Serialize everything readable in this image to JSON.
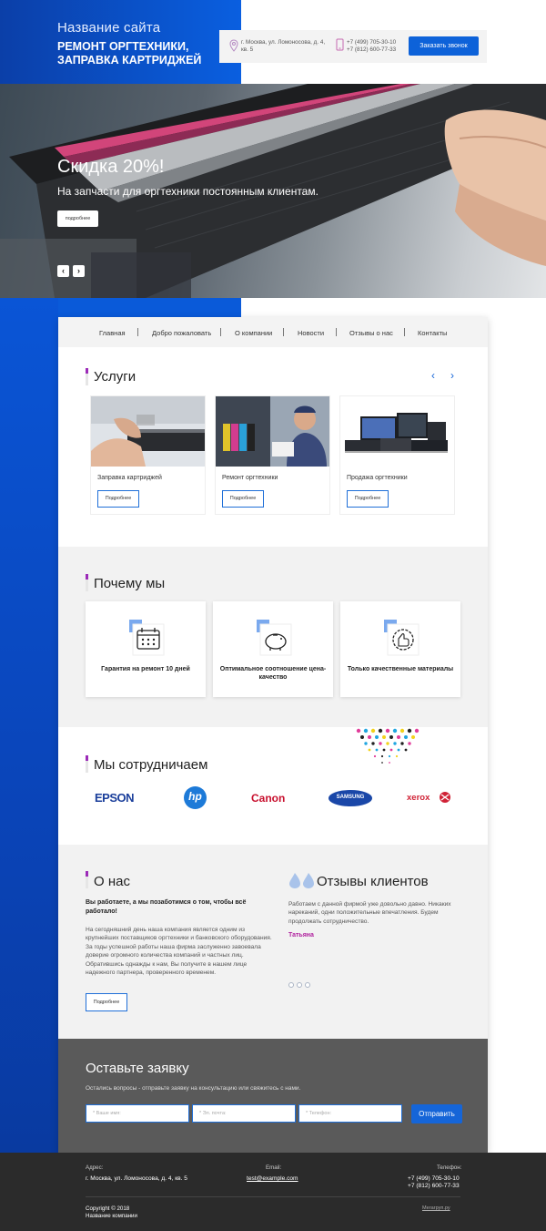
{
  "header": {
    "site_name": "Название сайта",
    "tagline": "Ремонт оргтехники, заправка картриджей",
    "address": "г. Москва, ул. Ломоносова, д. 4, кв. 5",
    "phone1": "+7 (499) 705-30-10",
    "phone2": "+7 (812) 600-77-33",
    "call_button": "Заказать звонок"
  },
  "hero": {
    "title": "Скидка 20%!",
    "subtitle": "На запчасти для оргтехники постоянным клиентам.",
    "more_button": "подробнее",
    "prev_icon": "‹",
    "next_icon": "›"
  },
  "nav": {
    "items": [
      "Главная",
      "Добро пожаловать",
      "О компании",
      "Новости",
      "Отзывы о нас",
      "Контакты"
    ]
  },
  "services": {
    "title": "Услуги",
    "prev_icon": "‹",
    "next_icon": "›",
    "items": [
      {
        "name": "Заправка картриджей",
        "button": "Подробнее"
      },
      {
        "name": "Ремонт оргтехники",
        "button": "Подробнее"
      },
      {
        "name": "Продажа оргтехники",
        "button": "Подробнее"
      }
    ]
  },
  "why": {
    "title": "Почему мы",
    "items": [
      {
        "text": "Гарантия на ремонт 10 дней",
        "icon": "calendar-icon"
      },
      {
        "text": "Оптимальное соотношение цена-качество",
        "icon": "piggy-bank-icon"
      },
      {
        "text": "Только качественные материалы",
        "icon": "thumbs-up-icon"
      }
    ]
  },
  "partners": {
    "title": "Мы сотрудничаем",
    "brands": [
      "EPSON",
      "hp",
      "Canon",
      "SAMSUNG",
      "xerox"
    ]
  },
  "about": {
    "title": "О нас",
    "lead": "Вы работаете, а мы позаботимся о том, чтобы всё работало!",
    "text": "На сегодняшний день наша компания является одним из крупнейших поставщиков оргтехники и банковского оборудования. За годы успешной работы наша фирма заслуженно завоевала доверие огромного количества компаний и частных лиц. Обратившись однажды к нам, Вы получите в нашем лице надежного партнера, проверенного временем.",
    "button": "Подробнее"
  },
  "reviews": {
    "title": "Отзывы клиентов",
    "text": "Работаем с данной фирмой уже довольно давно. Никаких нареканий, одни положительные впечатления. Будем продолжать сотрудничество.",
    "author": "Татьяна"
  },
  "form": {
    "title": "Оставьте заявку",
    "subtitle": "Остались вопросы - отправьте заявку на консультацию или свяжитесь с нами.",
    "name_placeholder": "* Ваше имя:",
    "email_placeholder": "* Эл. почта:",
    "phone_placeholder": "* Телефон:",
    "submit": "Отправить"
  },
  "footer": {
    "address_label": "Адрес:",
    "address": "г. Москва, ул. Ломоносова, д. 4, кв. 5",
    "email_label": "Email:",
    "email": "test@example.com",
    "phone_label": "Телефон:",
    "phone1": "+7 (499) 705-30-10",
    "phone2": "+7 (812) 600-77-33",
    "copyright": "Copyright © 2018",
    "company": "Название компании",
    "dev_link": "Мегагруп.ру"
  },
  "colors": {
    "primary": "#0d62d9",
    "accent": "#9c2bb8",
    "footer_bg": "#2b2b2b",
    "form_bg": "#5a5a5a"
  }
}
